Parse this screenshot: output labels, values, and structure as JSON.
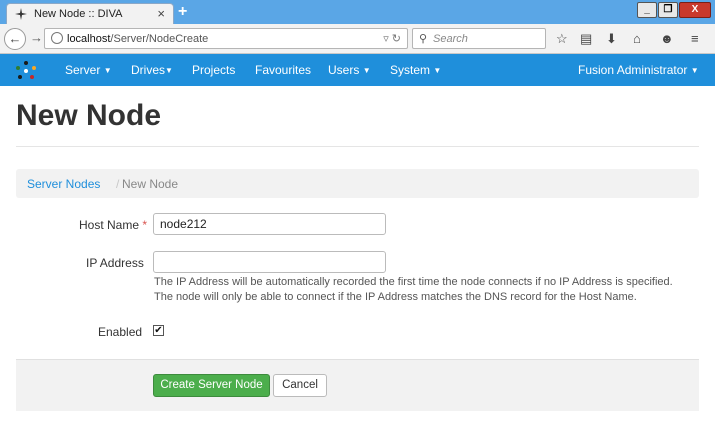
{
  "browser": {
    "tab_title": "New Node :: DIVA",
    "tab_close": "×",
    "new_tab": "+",
    "url_host": "localhost",
    "url_path": "/Server/NodeCreate",
    "search_placeholder": "Search",
    "window_min": "_",
    "window_max": "❐",
    "window_close": "X"
  },
  "nav": {
    "items": [
      {
        "label": "Server",
        "caret": true
      },
      {
        "label": "Drives",
        "caret": true
      },
      {
        "label": "Projects",
        "caret": false
      },
      {
        "label": "Favourites",
        "caret": false
      },
      {
        "label": "Users",
        "caret": true
      },
      {
        "label": "System",
        "caret": true
      }
    ],
    "user": "Fusion Administrator"
  },
  "page": {
    "title": "New Node",
    "breadcrumb": {
      "parent": "Server Nodes",
      "separator": "/",
      "current": "New Node"
    }
  },
  "form": {
    "host_name_label": "Host Name",
    "required_marker": "*",
    "host_name_value": "node212",
    "ip_address_label": "IP Address",
    "ip_address_value": "",
    "ip_help_line1": "The IP Address will be automatically recorded the first time the node connects if no IP Address is specified.",
    "ip_help_line2": "The node will only be able to connect if the IP Address matches the DNS record for the Host Name.",
    "enabled_label": "Enabled",
    "enabled_checked": true,
    "enabled_mark": "✔",
    "submit_label": "Create Server Node",
    "cancel_label": "Cancel"
  },
  "colors": {
    "navbar": "#1f8fdb",
    "primary_button": "#4cae4c",
    "link": "#1f8fdb"
  }
}
